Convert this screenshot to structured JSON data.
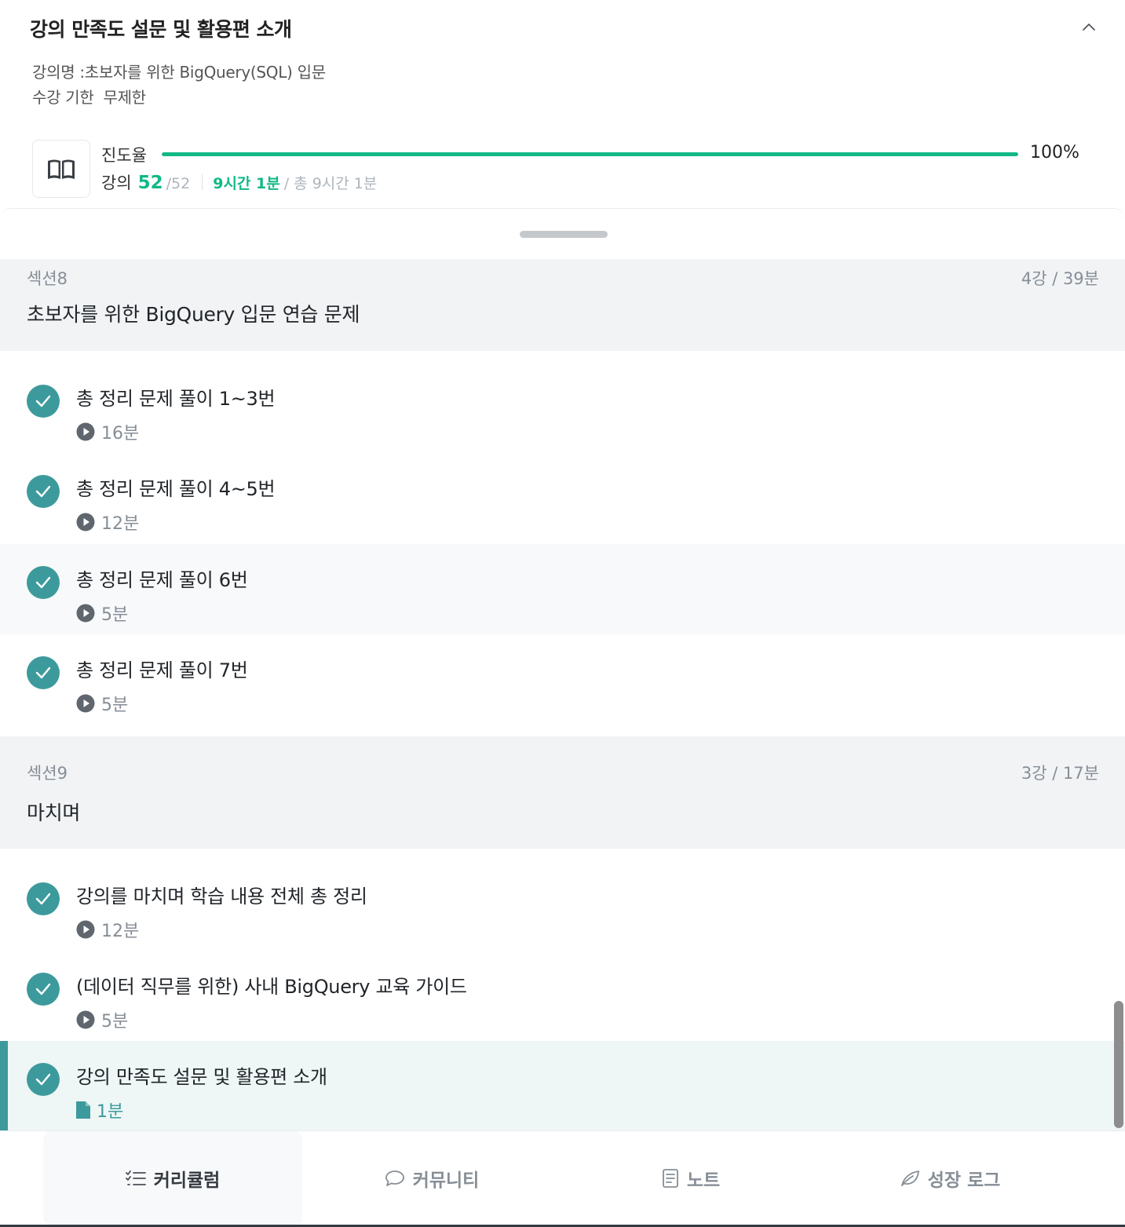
{
  "header": {
    "title": "강의 만족도 설문 및 활용편 소개",
    "course_name": "강의명 :초보자를 위한 BigQuery(SQL) 입문",
    "period_label": "수강 기한",
    "period_value": "무제한"
  },
  "progress": {
    "label": "진도율",
    "percent_value": 100,
    "percent_text": "100%",
    "lessons_label": "강의",
    "lessons_done": "52",
    "lessons_total": "/52",
    "time_done": "9시간 1분",
    "time_total": "/ 총 9시간 1분"
  },
  "sections": [
    {
      "number": "섹션8",
      "meta": "4강 / 39분",
      "title": "초보자를 위한 BigQuery 입문 연습 문제",
      "lessons": [
        {
          "title": "총 정리 문제 풀이 1~3번",
          "duration": "16분",
          "type": "video"
        },
        {
          "title": "총 정리 문제 풀이 4~5번",
          "duration": "12분",
          "type": "video"
        },
        {
          "title": "총 정리 문제 풀이 6번",
          "duration": "5분",
          "type": "video"
        },
        {
          "title": "총 정리 문제 풀이 7번",
          "duration": "5분",
          "type": "video"
        }
      ]
    },
    {
      "number": "섹션9",
      "meta": "3강 / 17분",
      "title": "마치며",
      "lessons": [
        {
          "title": "강의를 마치며 학습 내용 전체 총 정리",
          "duration": "12분",
          "type": "video"
        },
        {
          "title": "(데이터 직무를 위한) 사내 BigQuery 교육 가이드",
          "duration": "5분",
          "type": "video"
        },
        {
          "title": "강의 만족도 설문 및 활용편 소개",
          "duration": "1분",
          "type": "document"
        }
      ]
    }
  ],
  "bottom_nav": {
    "curriculum": "커리큘럼",
    "community": "커뮤니티",
    "note": "노트",
    "growth_log": "성장 로그"
  },
  "colors": {
    "accent_green": "#12b886",
    "check_teal": "#3d9a9c",
    "section_bg": "#f1f3f5"
  },
  "icons": [
    "chevron-up-icon",
    "book-icon",
    "check-icon",
    "play-circle-icon",
    "document-icon",
    "list-check-icon",
    "chat-bubble-icon",
    "note-icon",
    "leaf-icon"
  ]
}
